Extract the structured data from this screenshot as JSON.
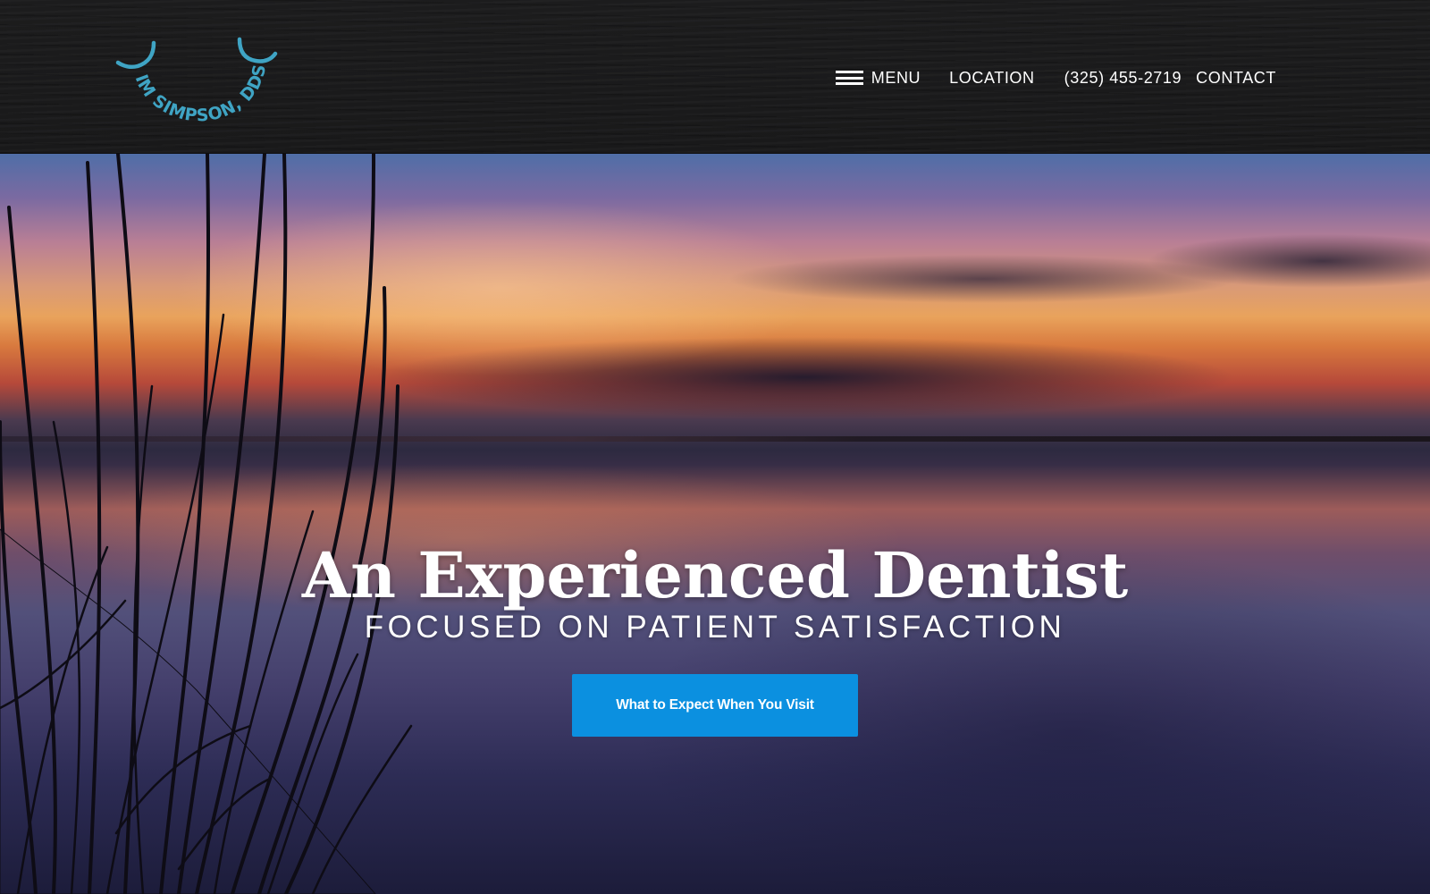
{
  "header": {
    "logo_text": "TIM SIMPSON, DDS",
    "nav": {
      "menu_label": "MENU",
      "location_label": "LOCATION",
      "phone_label": "(325) 455-2719",
      "contact_label": "CONTACT"
    }
  },
  "hero": {
    "title": "An Experienced Dentist",
    "subtitle": "FOCUSED ON PATIENT SATISFACTION",
    "cta_label": "What to Expect When You Visit"
  },
  "colors": {
    "logo_accent": "#3fa4c4",
    "cta_background": "#0b90e0",
    "header_background": "#1a1a1b"
  },
  "icons": {
    "menu": "hamburger-icon"
  }
}
